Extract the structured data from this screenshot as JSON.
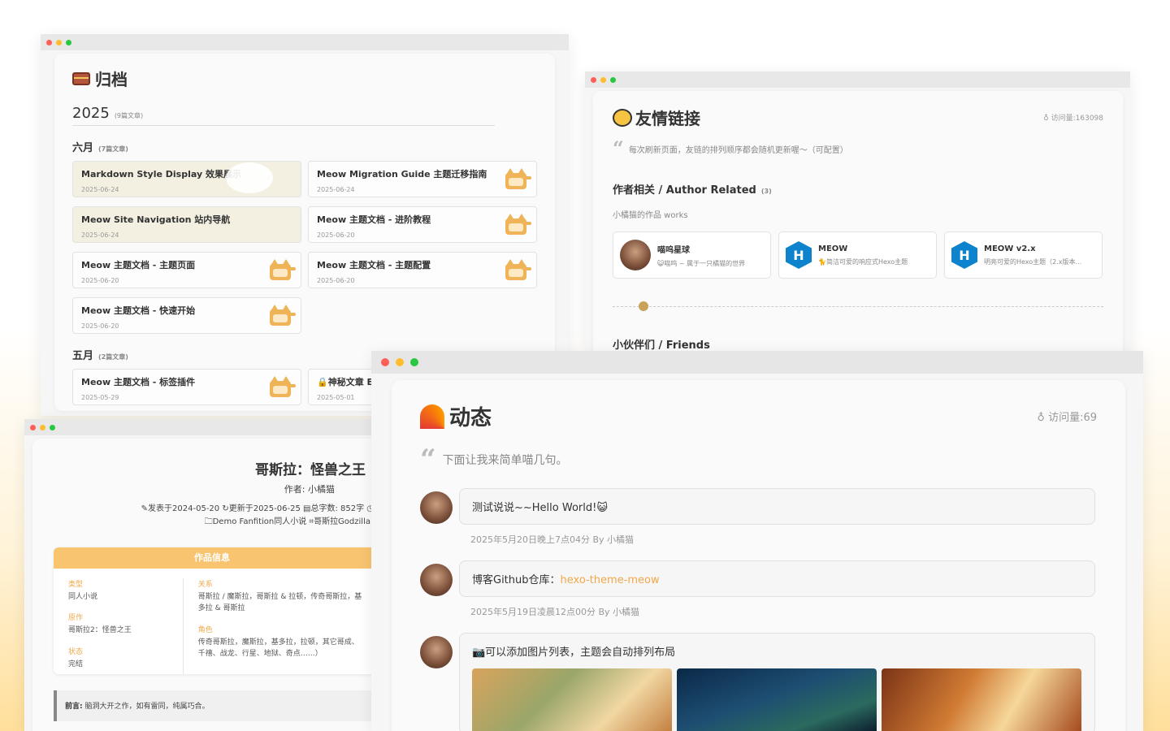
{
  "archive": {
    "title": "归档",
    "year": "2025",
    "year_count": "(9篇文章)",
    "months": [
      {
        "name": "六月",
        "count": "(7篇文章)",
        "posts": [
          {
            "title": "Markdown Style Display 效果展示",
            "date": "2025-06-24"
          },
          {
            "title": "Meow Migration Guide 主题迁移指南",
            "date": "2025-06-24"
          },
          {
            "title": "Meow Site Navigation 站内导航",
            "date": "2025-06-24"
          },
          {
            "title": "Meow 主题文档 - 进阶教程",
            "date": "2025-06-20"
          },
          {
            "title": "Meow 主题文档 - 主题页面",
            "date": "2025-06-20"
          },
          {
            "title": "Meow 主题文档 - 主题配置",
            "date": "2025-06-20"
          },
          {
            "title": "Meow 主题文档 - 快速开始",
            "date": "2025-06-20"
          }
        ]
      },
      {
        "name": "五月",
        "count": "(2篇文章)",
        "posts": [
          {
            "title": "Meow 主题文档 - 标签插件",
            "date": "2025-05-29"
          },
          {
            "title": "🔒神秘文章 Ei",
            "date": "2025-05-01"
          }
        ]
      }
    ]
  },
  "friends": {
    "title": "友情链接",
    "visits": "♁ 访问量:163098",
    "quote": "每次刷新页面，友链的排列顺序都会随机更新喔～（可配置）",
    "section": "作者相关 / Author Related",
    "section_count": "(3)",
    "sub": "小橘猫的作品 works",
    "links": [
      {
        "name": "喵呜星球",
        "desc": "😺喵呜 ~ 属于一只橘猫的世界"
      },
      {
        "name": "MEOW",
        "desc": "🐈简洁可爱的响应式Hexo主题"
      },
      {
        "name": "MEOW v2.x",
        "desc": "明亮可爱的Hexo主题（2.x版本..."
      }
    ],
    "next_section": "小伙伴们 / Friends"
  },
  "novel": {
    "title": "哥斯拉：怪兽之王",
    "author": "作者: 小橘猫",
    "meta_line1": "✎发表于2024-05-20  ↻更新于2025-06-25  ▤总字数: 852字  ◷",
    "meta_line2": "🗀Demo  Fanfition同人小说  ⌗哥斯拉Godzilla",
    "info_header": "作品信息",
    "fields_left": [
      {
        "label": "类型",
        "value": "同人小说"
      },
      {
        "label": "原作",
        "value": "哥斯拉2：怪兽之王"
      },
      {
        "label": "状态",
        "value": "完结"
      }
    ],
    "fields_right": [
      {
        "label": "关系",
        "value": "哥斯拉 / 魔斯拉，哥斯拉 & 拉顿，传奇哥斯拉，基多拉 & 哥斯拉"
      },
      {
        "label": "角色",
        "value": "传奇哥斯拉，魔斯拉，基多拉，拉顿，其它哥成、千禧、战龙、行星、地狱、奇点……）"
      }
    ],
    "preface_label": "前言:",
    "preface_text": "脑洞大开之作，如有雷同，纯属巧合。"
  },
  "moments": {
    "title": "动态",
    "visits": "♁ 访问量:69",
    "quote": "下面让我来简单喵几句。",
    "posts": [
      {
        "text": "测试说说~~Hello World!😺",
        "time": "2025年5月20日晚上7点04分  By 小橘猫"
      },
      {
        "text_prefix": "博客Github仓库：",
        "link": "hexo-theme-meow",
        "time": "2025年5月19日凌晨12点00分  By 小橘猫"
      },
      {
        "text": "📷可以添加图片列表，主题会自动排列布局"
      }
    ]
  }
}
